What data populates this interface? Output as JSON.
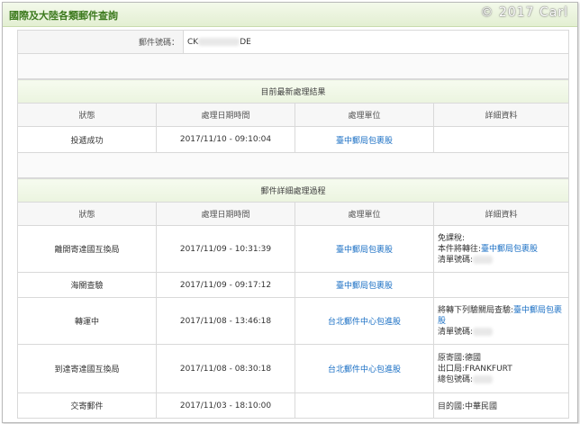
{
  "title": "國際及大陸各類郵件查詢",
  "watermark": "© 2017 Carl",
  "tracking": {
    "label": "郵件號碼：",
    "prefix": "CK",
    "suffix": "DE"
  },
  "latest": {
    "section_title": "目前最新處理結果",
    "headers": [
      "狀態",
      "處理日期時間",
      "處理單位",
      "詳細資料"
    ],
    "row": {
      "status": "投遞成功",
      "datetime": "2017/11/10 - 09:10:04",
      "unit": "臺中郵局包裹股",
      "detail": ""
    }
  },
  "history": {
    "section_title": "郵件詳細處理過程",
    "headers": [
      "狀態",
      "處理日期時間",
      "處理單位",
      "詳細資料"
    ],
    "rows": [
      {
        "status": "離開寄達國互換局",
        "datetime": "2017/11/09 - 10:31:39",
        "unit": "臺中郵局包裹股",
        "detail": {
          "line1": "免課稅:",
          "line2_prefix": "本件將轉往:",
          "line2_link": "臺中郵局包裹股",
          "line3": "清單號碼:"
        }
      },
      {
        "status": "海關查驗",
        "datetime": "2017/11/09 - 09:17:12",
        "unit": "臺中郵局包裹股"
      },
      {
        "status": "轉運中",
        "datetime": "2017/11/08 - 13:46:18",
        "unit": "台北郵件中心包進股",
        "detail": {
          "line1_prefix": "將轉下列驗關局查驗:",
          "line1_link": "臺中郵局包裹股",
          "line3": "清單號碼:"
        }
      },
      {
        "status": "到達寄達國互換局",
        "datetime": "2017/11/08 - 08:30:18",
        "unit": "台北郵件中心包進股",
        "detail": {
          "line1": "原寄國:德國",
          "line2": "出口局:FRANKFURT",
          "line3": "總包號碼:"
        }
      },
      {
        "status": "交寄郵件",
        "datetime": "2017/11/03 - 18:10:00",
        "unit": "",
        "detail": {
          "line1": "目的國:中華民國"
        }
      }
    ]
  }
}
